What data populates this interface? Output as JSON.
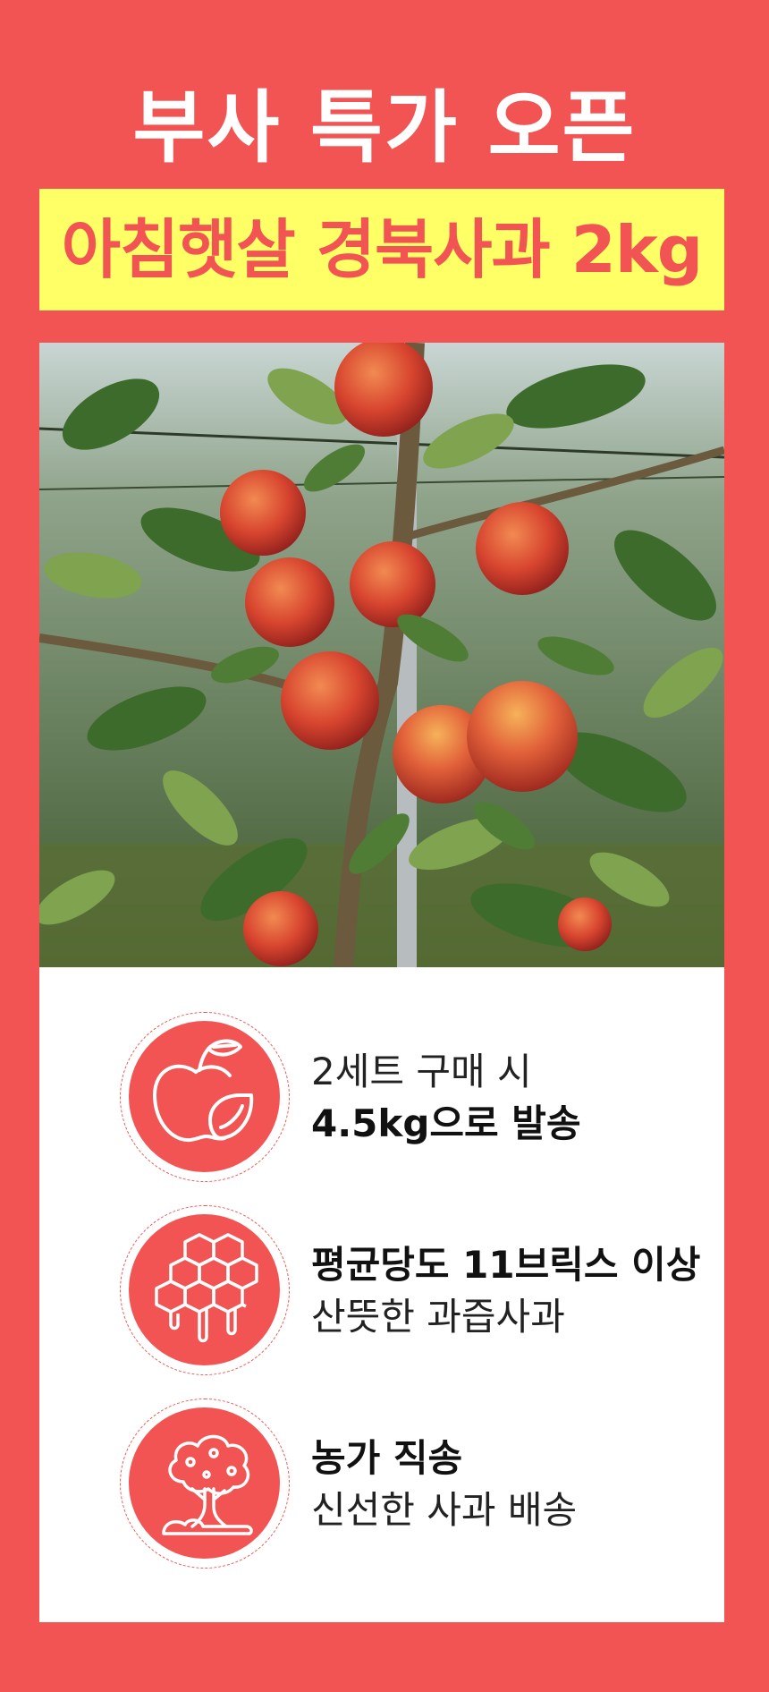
{
  "headline": "부사 특가 오픈",
  "subheadline": "아침햇살 경북사과 2kg",
  "photo": {
    "description_icon": "apple-orchard-photo"
  },
  "features": [
    {
      "icon": "apple-icon",
      "line1": "2세트 구매 시",
      "line2": "4.5kg으로 발송",
      "bold_line": 2
    },
    {
      "icon": "honeycomb-icon",
      "line1": "평균당도 11브릭스 이상",
      "line2": "산뜻한 과즙사과",
      "bold_line": 1
    },
    {
      "icon": "tree-icon",
      "line1": "농가 직송",
      "line2": "신선한 사과 배송",
      "bold_line": 1
    }
  ],
  "colors": {
    "brand_red": "#f25454",
    "highlight_yellow": "#ffff66",
    "panel_white": "#ffffff"
  }
}
